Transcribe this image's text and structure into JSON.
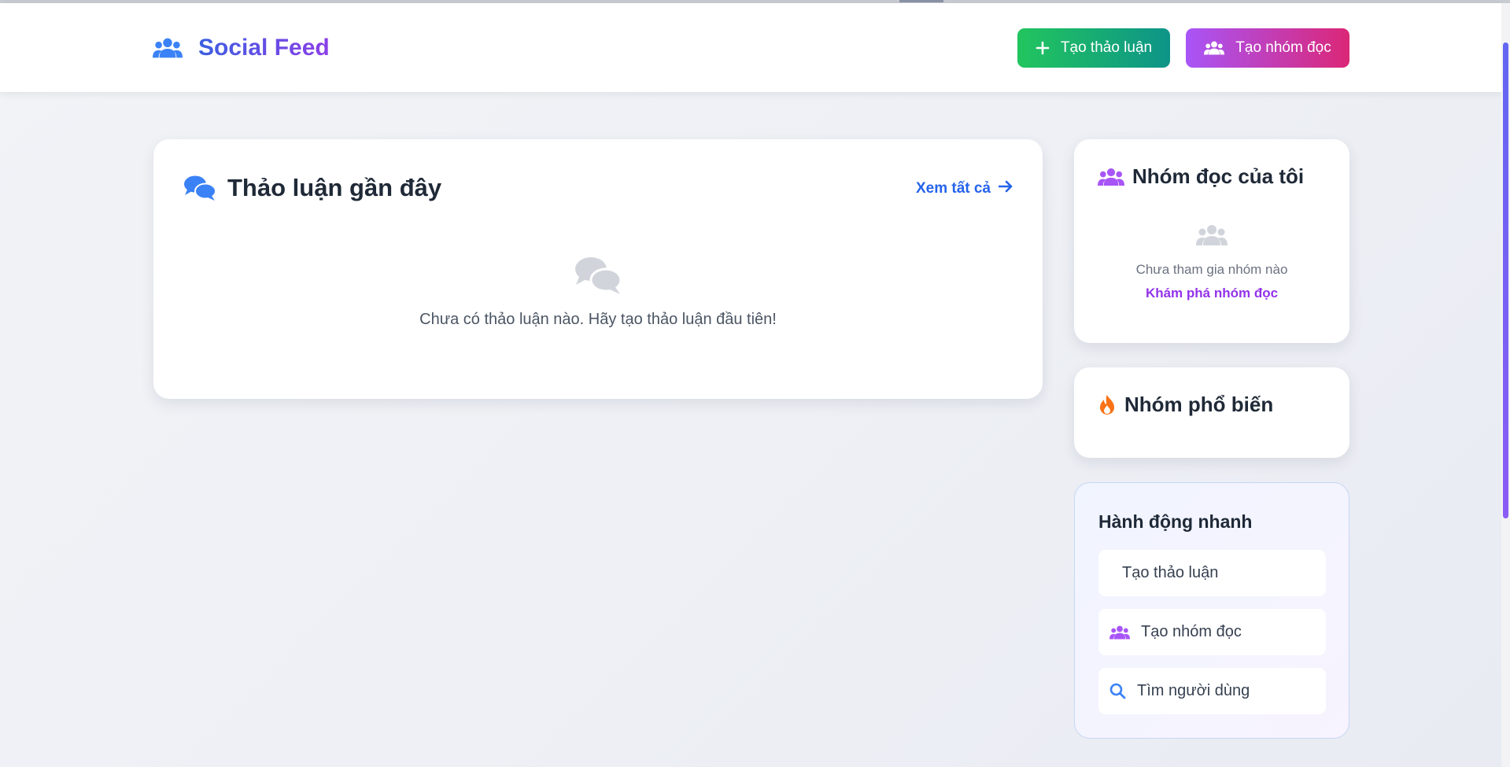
{
  "header": {
    "brand": {
      "title": "Social Feed",
      "icon": "users-icon"
    },
    "create_discussion_label": "Tạo thảo luận",
    "create_group_label": "Tạo nhóm đọc"
  },
  "recent": {
    "title": "Thảo luận gần đây",
    "see_all": "Xem tất cả",
    "empty_message": "Chưa có thảo luận nào. Hãy tạo thảo luận đầu tiên!"
  },
  "my_groups": {
    "title": "Nhóm đọc của tôi",
    "empty_message": "Chưa tham gia nhóm nào",
    "explore_link": "Khám phá nhóm đọc"
  },
  "popular": {
    "title": "Nhóm phổ biến"
  },
  "quick_actions": {
    "title": "Hành động nhanh",
    "items": [
      {
        "label": "Tạo thảo luận",
        "icon": "plus-icon"
      },
      {
        "label": "Tạo nhóm đọc",
        "icon": "users-icon"
      },
      {
        "label": "Tìm người dùng",
        "icon": "search-icon"
      }
    ]
  },
  "colors": {
    "brand_gradient": [
      "#3b5fe0",
      "#8b3ee8"
    ],
    "green_button": [
      "#22c55e",
      "#0d9488"
    ],
    "pink_button": [
      "#a855f7",
      "#db2777"
    ],
    "link_blue": "#2563eb",
    "link_purple": "#9333ea",
    "fire_orange": "#f97316"
  }
}
